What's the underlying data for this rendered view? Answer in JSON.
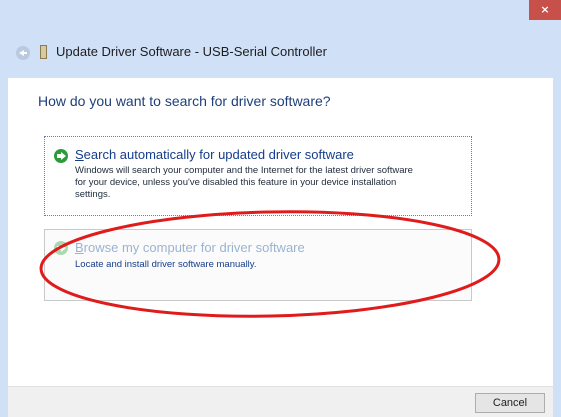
{
  "window": {
    "title": "Update Driver Software - USB-Serial Controller",
    "close_glyph": "×",
    "back_icon": "back-arrow-icon",
    "device_icon": "usb-device-icon"
  },
  "main": {
    "heading": "How do you want to search for driver software?",
    "options": [
      {
        "title_mnemonic": "S",
        "title_rest": "earch automatically for updated driver software",
        "description": "Windows will search your computer and the Internet for the latest driver software\nfor your device, unless you've disabled this feature in your device installation\nsettings.",
        "icon": "green-arrow-icon",
        "state": "focused"
      },
      {
        "title_mnemonic": "B",
        "title_rest": "rowse my computer for driver software",
        "description": "Locate and install driver software manually.",
        "icon": "green-arrow-icon",
        "state": "hover"
      }
    ]
  },
  "footer": {
    "cancel_label": "Cancel"
  },
  "annotation": {
    "shape": "ellipse",
    "color": "#e01b1b",
    "target": "browse-option"
  },
  "colors": {
    "frame": "#cfe0f7",
    "close_button": "#c7504b",
    "heading": "#1f3f7a",
    "link_text": "#153d8a",
    "hover_link_text": "#9bb3d3",
    "arrow_green": "#2e9b3a"
  }
}
